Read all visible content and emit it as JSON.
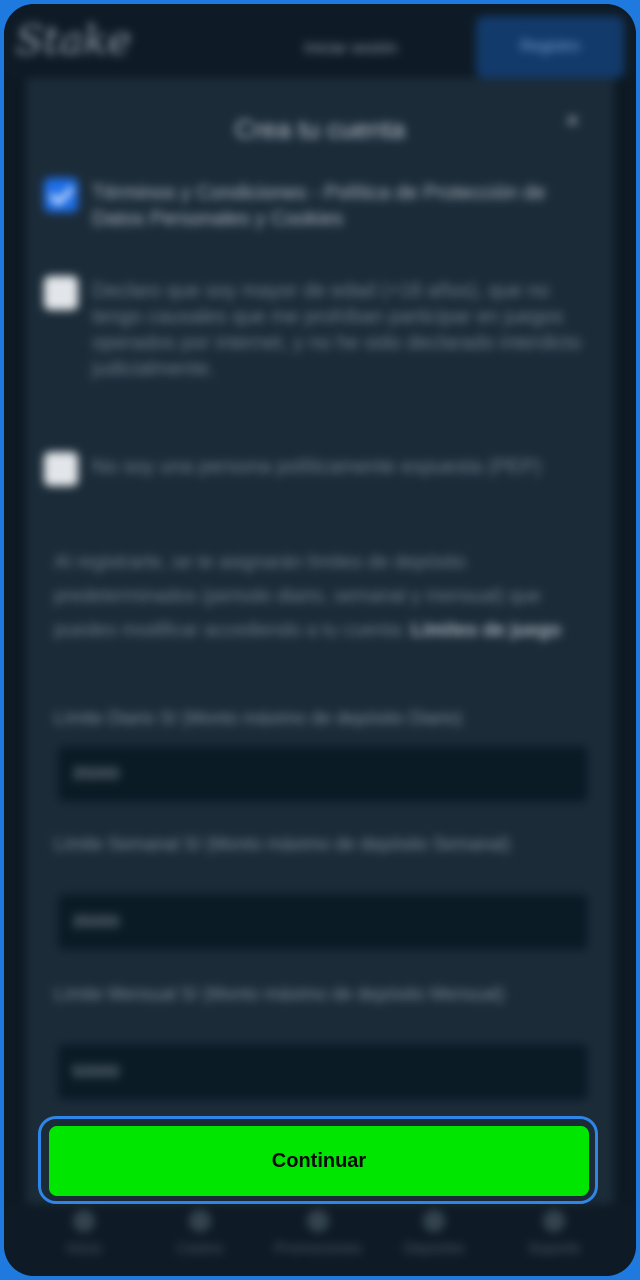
{
  "header": {
    "logo_text": "Stake",
    "login_label": "Iniciar sesión",
    "register_label": "Registro"
  },
  "modal": {
    "title": "Crea tu cuenta",
    "close_label": "×",
    "checkboxes": [
      {
        "label": "Términos y Condiciones - Política de Protección de Datos Personales y Cookies",
        "checked": true
      },
      {
        "label": "Declaro que soy mayor de edad (+18 años), que no tengo causales que me prohíban participar en juegos operados por internet, y no he sido declarado interdicto judicialmente.",
        "checked": false
      },
      {
        "label": "No soy una persona políticamente expuesta (PEP)",
        "checked": false
      }
    ],
    "info_text": "Al registrarte, se te asignarán límites de depósito predeterminados (periodo diario, semanal y mensual) que puedes modificar accediendo a tu cuenta:",
    "info_link": "Límites de juego",
    "fields": [
      {
        "label": "Límite Diario S/ (Monto máximo de depósito Diario)",
        "value": "35000"
      },
      {
        "label": "Límite Semanal S/ (Monto máximo de depósito Semanal)",
        "value": "35000"
      },
      {
        "label": "Límite Mensual S/ (Monto máximo de depósito Mensual)",
        "value": "50000"
      }
    ]
  },
  "cta": {
    "label": "Continuar"
  },
  "bottom_nav": {
    "items": [
      {
        "label": "Inicio",
        "icon": "home-icon"
      },
      {
        "label": "Casino",
        "icon": "casino-icon"
      },
      {
        "label": "Promociones",
        "icon": "gift-icon"
      },
      {
        "label": "Deportes",
        "icon": "sports-icon"
      },
      {
        "label": "Soporte",
        "icon": "support-icon"
      }
    ]
  },
  "colors": {
    "accent": "#00e600",
    "checkbox_checked": "#1e6fe8",
    "focus_ring": "#2f86e8",
    "background": "#0d1a24"
  }
}
